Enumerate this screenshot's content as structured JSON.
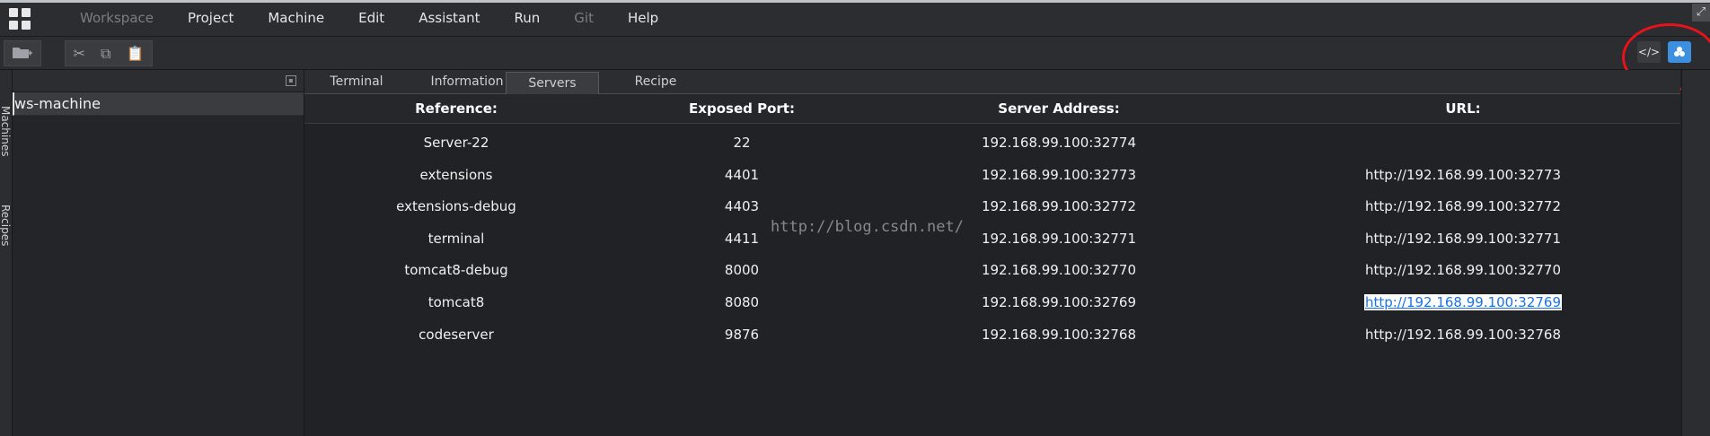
{
  "menu": {
    "items": [
      {
        "label": "Workspace",
        "dim": true
      },
      {
        "label": "Project",
        "dim": false
      },
      {
        "label": "Machine",
        "dim": false
      },
      {
        "label": "Edit",
        "dim": false
      },
      {
        "label": "Assistant",
        "dim": false
      },
      {
        "label": "Run",
        "dim": false
      },
      {
        "label": "Git",
        "dim": true
      },
      {
        "label": "Help",
        "dim": false
      }
    ]
  },
  "toolbar": {
    "right_icons": [
      "code-icon",
      "docker-icon"
    ]
  },
  "side_tabs": [
    "Machines",
    "Recipes"
  ],
  "left_panel": {
    "machine_name": "ws-machine"
  },
  "tabs": [
    {
      "label": "Terminal"
    },
    {
      "label": "Information"
    },
    {
      "label": "Servers"
    },
    {
      "label": "Recipe"
    }
  ],
  "table": {
    "headers": {
      "reference": "Reference:",
      "port": "Exposed Port:",
      "address": "Server Address:",
      "url": "URL:"
    },
    "rows": [
      {
        "reference": "Server-22",
        "port": "22",
        "address": "192.168.99.100:32774",
        "url": ""
      },
      {
        "reference": "extensions",
        "port": "4401",
        "address": "192.168.99.100:32773",
        "url": "http://192.168.99.100:32773"
      },
      {
        "reference": "extensions-debug",
        "port": "4403",
        "address": "192.168.99.100:32772",
        "url": "http://192.168.99.100:32772"
      },
      {
        "reference": "terminal",
        "port": "4411",
        "address": "192.168.99.100:32771",
        "url": "http://192.168.99.100:32771"
      },
      {
        "reference": "tomcat8-debug",
        "port": "8000",
        "address": "192.168.99.100:32770",
        "url": "http://192.168.99.100:32770"
      },
      {
        "reference": "tomcat8",
        "port": "8080",
        "address": "192.168.99.100:32769",
        "url": "http://192.168.99.100:32769"
      },
      {
        "reference": "codeserver",
        "port": "9876",
        "address": "192.168.99.100:32768",
        "url": "http://192.168.99.100:32768"
      }
    ]
  },
  "watermark": "http://blog.csdn.net/",
  "colors": {
    "annotation_circle": "#e8121b",
    "active_icon": "#3d8fe0",
    "link": "#1a73e8"
  }
}
